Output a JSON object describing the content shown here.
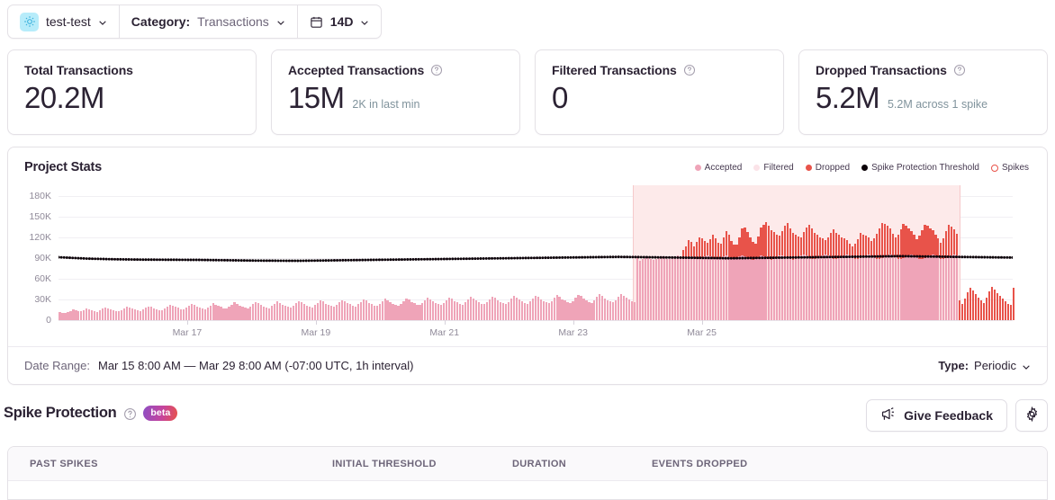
{
  "topbar": {
    "project": "test-test",
    "category_label": "Category:",
    "category_value": "Transactions",
    "range_value": "14D"
  },
  "cards": [
    {
      "title": "Total Transactions",
      "value": "20.2M",
      "sub": "",
      "help": false
    },
    {
      "title": "Accepted Transactions",
      "value": "15M",
      "sub": "2K in last min",
      "help": true
    },
    {
      "title": "Filtered Transactions",
      "value": "0",
      "sub": "",
      "help": true
    },
    {
      "title": "Dropped Transactions",
      "value": "5.2M",
      "sub": "5.2M across 1 spike",
      "help": true
    }
  ],
  "panel": {
    "title": "Project Stats",
    "legend": [
      {
        "label": "Accepted",
        "color": "#efa4b8",
        "shape": "dot"
      },
      {
        "label": "Filtered",
        "color": "#fbe3e8",
        "shape": "dot"
      },
      {
        "label": "Dropped",
        "color": "#e8534a",
        "shape": "dot"
      },
      {
        "label": "Spike Protection Threshold",
        "color": "#0b0108",
        "shape": "dot"
      },
      {
        "label": "Spikes",
        "color": "#e8534a",
        "shape": "ring"
      }
    ],
    "footer": {
      "date_range_label": "Date Range:",
      "date_range_value": "Mar 15 8:00 AM — Mar 29 8:00 AM (-07:00 UTC, 1h interval)",
      "type_label": "Type:",
      "type_value": "Periodic"
    }
  },
  "chart_data": {
    "type": "bar",
    "stacked": true,
    "title": "Project Stats",
    "xlabel": "",
    "ylabel": "",
    "ylim": [
      0,
      195000
    ],
    "grid": true,
    "legend_position": "top-right",
    "ytick_labels": [
      "180K",
      "150K",
      "120K",
      "90K",
      "60K",
      "30K",
      "0"
    ],
    "ytick_values": [
      180000,
      150000,
      120000,
      90000,
      60000,
      30000,
      0
    ],
    "xtick_labels": [
      "Mar 17",
      "Mar 19",
      "Mar 21",
      "Mar 23",
      "Mar 25"
    ],
    "xtick_index": [
      48,
      96,
      144,
      192,
      240
    ],
    "interval": "1h",
    "n_points": 336,
    "spike_region": {
      "start_index": 214,
      "end_index": 335,
      "label": "1 spike",
      "fill": "#fdeaea"
    },
    "series": [
      {
        "name": "Accepted",
        "color": "#efa4b8",
        "values": [
          12000,
          10500,
          9800,
          11200,
          13400,
          15600,
          14800,
          13200,
          12600,
          14100,
          16300,
          15200,
          13800,
          12400,
          11600,
          13900,
          16800,
          18200,
          17100,
          15400,
          14200,
          13100,
          12800,
          14600,
          17200,
          19400,
          18100,
          16500,
          15200,
          14000,
          13500,
          15800,
          18600,
          20100,
          19200,
          17400,
          16100,
          14800,
          14200,
          16500,
          19800,
          22400,
          21000,
          19100,
          17600,
          16200,
          15400,
          17800,
          20600,
          23100,
          21800,
          19600,
          18200,
          16800,
          15900,
          18300,
          21400,
          24200,
          22600,
          20400,
          18900,
          17300,
          16400,
          18900,
          22100,
          25400,
          23800,
          21300,
          19700,
          18100,
          17200,
          19600,
          22800,
          25900,
          24100,
          21800,
          20100,
          18400,
          17500,
          20200,
          23600,
          26800,
          25100,
          22600,
          20800,
          19100,
          18200,
          20900,
          24300,
          27600,
          25900,
          23200,
          21400,
          19700,
          18800,
          21500,
          25100,
          28400,
          26700,
          23900,
          22100,
          20300,
          19400,
          22200,
          25800,
          29200,
          27400,
          24600,
          22800,
          20900,
          20000,
          22800,
          26400,
          29800,
          28000,
          25200,
          23300,
          21400,
          20500,
          23300,
          27100,
          30600,
          28700,
          25800,
          23900,
          22000,
          21000,
          23900,
          27800,
          31400,
          29400,
          26500,
          24500,
          22500,
          21500,
          24400,
          28400,
          32100,
          30100,
          27100,
          25000,
          23000,
          22000,
          24900,
          29000,
          32800,
          30700,
          27600,
          25500,
          23500,
          22400,
          25400,
          29600,
          33500,
          31400,
          28200,
          26100,
          24000,
          22900,
          25900,
          30200,
          34200,
          32000,
          28800,
          26600,
          24500,
          23300,
          26400,
          30800,
          34800,
          32600,
          29400,
          27100,
          25000,
          23800,
          26900,
          31400,
          35500,
          33200,
          29900,
          27600,
          25400,
          24200,
          27400,
          32000,
          36200,
          33900,
          30500,
          28100,
          25900,
          24700,
          27900,
          32600,
          36900,
          34500,
          31100,
          28700,
          26400,
          25100,
          28400,
          33200,
          37500,
          35100,
          31700,
          29200,
          26900,
          25600,
          28900,
          33800,
          38200,
          35700,
          32200,
          29700,
          27300,
          26000,
          92000,
          86000,
          88000,
          90000,
          91000,
          89000,
          87000,
          88000,
          90000,
          92000,
          91000,
          89000,
          88000,
          90000,
          92000,
          93000,
          91000,
          89000,
          88000,
          90000,
          92000,
          91000,
          89000,
          88000,
          90000,
          92000,
          94000,
          92000,
          90000,
          89000,
          88000,
          90000,
          92000,
          93000,
          91000,
          89000,
          88000,
          90000,
          92000,
          94000,
          92000,
          90000,
          88000,
          87000,
          89000,
          91000,
          93000,
          92000,
          90000,
          88000,
          87000,
          89000,
          91000,
          93000,
          94000,
          92000,
          90000,
          88000,
          87000,
          89000,
          91000,
          93000,
          95000,
          93000,
          91000,
          89000,
          88000,
          90000,
          92000,
          94000,
          95000,
          93000,
          91000,
          89000,
          88000,
          90000,
          92000,
          94000,
          95000,
          93000,
          91000,
          89000,
          88000,
          90000,
          92000,
          94000,
          95000,
          93000,
          91000,
          89000,
          88000,
          90000,
          92000,
          94000,
          95000,
          93000,
          91000,
          89000,
          88000,
          90000,
          92000,
          94000,
          95000,
          93000,
          91000,
          89000,
          88000,
          90000,
          92000,
          94000,
          95000,
          93000,
          91000,
          89000,
          88000,
          90000,
          92000,
          94000,
          95000,
          93000,
          0
        ]
      },
      {
        "name": "Dropped",
        "color": "#e8534a",
        "values": [
          0,
          0,
          0,
          0,
          0,
          0,
          0,
          0,
          0,
          0,
          0,
          0,
          0,
          0,
          0,
          0,
          0,
          0,
          0,
          0,
          0,
          0,
          0,
          0,
          0,
          0,
          0,
          0,
          0,
          0,
          0,
          0,
          0,
          0,
          0,
          0,
          0,
          0,
          0,
          0,
          0,
          0,
          0,
          0,
          0,
          0,
          0,
          0,
          0,
          0,
          0,
          0,
          0,
          0,
          0,
          0,
          0,
          0,
          0,
          0,
          0,
          0,
          0,
          0,
          0,
          0,
          0,
          0,
          0,
          0,
          0,
          0,
          0,
          0,
          0,
          0,
          0,
          0,
          0,
          0,
          0,
          0,
          0,
          0,
          0,
          0,
          0,
          0,
          0,
          0,
          0,
          0,
          0,
          0,
          0,
          0,
          0,
          0,
          0,
          0,
          0,
          0,
          0,
          0,
          0,
          0,
          0,
          0,
          0,
          0,
          0,
          0,
          0,
          0,
          0,
          0,
          0,
          0,
          0,
          0,
          0,
          0,
          0,
          0,
          0,
          0,
          0,
          0,
          0,
          0,
          0,
          0,
          0,
          0,
          0,
          0,
          0,
          0,
          0,
          0,
          0,
          0,
          0,
          0,
          0,
          0,
          0,
          0,
          0,
          0,
          0,
          0,
          0,
          0,
          0,
          0,
          0,
          0,
          0,
          0,
          0,
          0,
          0,
          0,
          0,
          0,
          0,
          0,
          0,
          0,
          0,
          0,
          0,
          0,
          0,
          0,
          0,
          0,
          0,
          0,
          0,
          0,
          0,
          0,
          0,
          0,
          0,
          0,
          0,
          0,
          0,
          0,
          0,
          0,
          0,
          0,
          0,
          0,
          0,
          0,
          0,
          0,
          0,
          0,
          0,
          0,
          0,
          0,
          0,
          0,
          0,
          0,
          0,
          0,
          0,
          0,
          0,
          0,
          0,
          0,
          0,
          0,
          0,
          0,
          0,
          0,
          0,
          0,
          0,
          0,
          0,
          0,
          12000,
          18000,
          26000,
          21000,
          16000,
          24000,
          31000,
          28000,
          22000,
          18000,
          25000,
          34000,
          29000,
          24000,
          20000,
          27000,
          36000,
          32000,
          26000,
          21000,
          19000,
          28000,
          38000,
          42000,
          37000,
          31000,
          26000,
          22000,
          30000,
          41000,
          46000,
          52000,
          48000,
          43000,
          38000,
          33000,
          29000,
          35000,
          44000,
          50000,
          45000,
          39000,
          34000,
          30000,
          26000,
          32000,
          41000,
          47000,
          43000,
          38000,
          33000,
          28000,
          24000,
          21000,
          27000,
          35000,
          42000,
          38000,
          33000,
          28000,
          24000,
          21000,
          18000,
          16000,
          22000,
          29000,
          36000,
          32000,
          28000,
          24000,
          21000,
          27000,
          36000,
          45000,
          51000,
          47000,
          42000,
          37000,
          32000,
          28000,
          34000,
          43000,
          49000,
          44000,
          39000,
          34000,
          30000,
          26000,
          33000,
          42000,
          48000,
          44000,
          39000,
          35000,
          31000,
          27000,
          23000,
          30000,
          39000,
          46000,
          41000,
          36000,
          32000,
          28000,
          24000,
          31000,
          40000,
          47000,
          43000,
          38000,
          33000,
          29000,
          25000,
          32000,
          41000,
          48000,
          44000,
          39000,
          35000,
          31000,
          27000,
          24000,
          22000,
          47000
        ]
      }
    ],
    "threshold_line": {
      "name": "Spike Protection Threshold",
      "color": "#0b0108",
      "style": "dotted",
      "approx_value": 90000,
      "values": [
        91000,
        90800,
        90600,
        90400,
        90200,
        90000,
        89800,
        89600,
        89400,
        89200,
        89000,
        88900,
        88800,
        88700,
        88600,
        88500,
        88400,
        88300,
        88200,
        88100,
        88000,
        87950,
        87900,
        87850,
        87800,
        87750,
        87700,
        87650,
        87600,
        87550,
        87500,
        87480,
        87460,
        87440,
        87420,
        87400,
        87380,
        87360,
        87340,
        87320,
        87300,
        87280,
        87260,
        87240,
        87220,
        87200,
        87180,
        87160,
        87140,
        87120,
        87100,
        87050,
        87000,
        86950,
        86900,
        86850,
        86800,
        86750,
        86700,
        86650,
        86600,
        86550,
        86500,
        86450,
        86400,
        86350,
        86300,
        86250,
        86200,
        86150,
        86100,
        86080,
        86060,
        86040,
        86020,
        86000,
        85980,
        85960,
        85940,
        85920,
        85900,
        85880,
        85860,
        85840,
        85820,
        85800,
        85850,
        85900,
        85950,
        86000,
        86050,
        86100,
        86150,
        86200,
        86250,
        86300,
        86350,
        86400,
        86450,
        86500,
        86550,
        86600,
        86650,
        86700,
        86750,
        86800,
        86850,
        86900,
        86950,
        87000,
        87050,
        87100,
        87150,
        87200,
        87250,
        87300,
        87350,
        87400,
        87450,
        87500,
        87550,
        87600,
        87650,
        87700,
        87750,
        87800,
        87850,
        87900,
        87950,
        88000,
        88050,
        88100,
        88150,
        88200,
        88250,
        88300,
        88350,
        88400,
        88450,
        88500,
        88550,
        88600,
        88650,
        88700,
        88750,
        88800,
        88850,
        88900,
        88950,
        89000,
        89050,
        89100,
        89150,
        89200,
        89250,
        89300,
        89350,
        89400,
        89450,
        89500,
        89550,
        89600,
        89650,
        89700,
        89750,
        89800,
        89850,
        89900,
        89950,
        90000,
        90050,
        90100,
        90150,
        90200,
        90250,
        90300,
        90350,
        90400,
        90450,
        90500,
        90550,
        90600,
        90650,
        90700,
        90750,
        90800,
        90850,
        90900,
        90950,
        91000,
        91050,
        91100,
        91150,
        91200,
        91250,
        91300,
        91350,
        91400,
        91450,
        91500,
        91450,
        91400,
        91350,
        91300,
        91250,
        91200,
        91150,
        91100,
        91050,
        91000,
        90950,
        90900,
        90850,
        90800,
        90750,
        90700,
        90650,
        90600,
        90550,
        90500,
        90450,
        90400,
        90350,
        90300,
        90250,
        90200,
        90150,
        90100,
        90050,
        90000,
        89950,
        89900,
        89850,
        89800,
        89750,
        89700,
        89650,
        89600,
        89550,
        89500,
        89550,
        89600,
        89650,
        89700,
        89750,
        89800,
        89850,
        89900,
        89950,
        90000,
        90050,
        90100,
        90150,
        90200,
        90250,
        90300,
        90350,
        90400,
        90450,
        90500,
        90550,
        90600,
        90650,
        90700,
        90750,
        90800,
        90850,
        90900,
        90950,
        91000,
        91050,
        91100,
        91150,
        91200,
        91250,
        91300,
        91350,
        91400,
        91450,
        91500,
        91550,
        91600,
        91650,
        91700,
        91750,
        91800,
        91850,
        91900,
        91950,
        92000,
        92050,
        92100,
        92150,
        92200,
        92250,
        92300,
        92350,
        92400,
        92450,
        92500,
        92450,
        92400,
        92350,
        92300,
        92250,
        92200,
        92150,
        92100,
        92050,
        92000,
        91950,
        91900,
        91850,
        91800,
        91750,
        91700,
        91650,
        91600,
        91550,
        91500,
        91450,
        91400,
        91350,
        91300,
        91250,
        91200,
        91150,
        91100,
        91050,
        91000,
        90950,
        90900,
        90850,
        90800,
        90750,
        90700,
        90650,
        90600,
        90550,
        90500
      ]
    }
  },
  "spike_protection": {
    "title": "Spike Protection",
    "badge": "beta",
    "feedback_button": "Give Feedback",
    "table": {
      "columns": [
        "PAST SPIKES",
        "INITIAL THRESHOLD",
        "DURATION",
        "EVENTS DROPPED"
      ]
    }
  }
}
